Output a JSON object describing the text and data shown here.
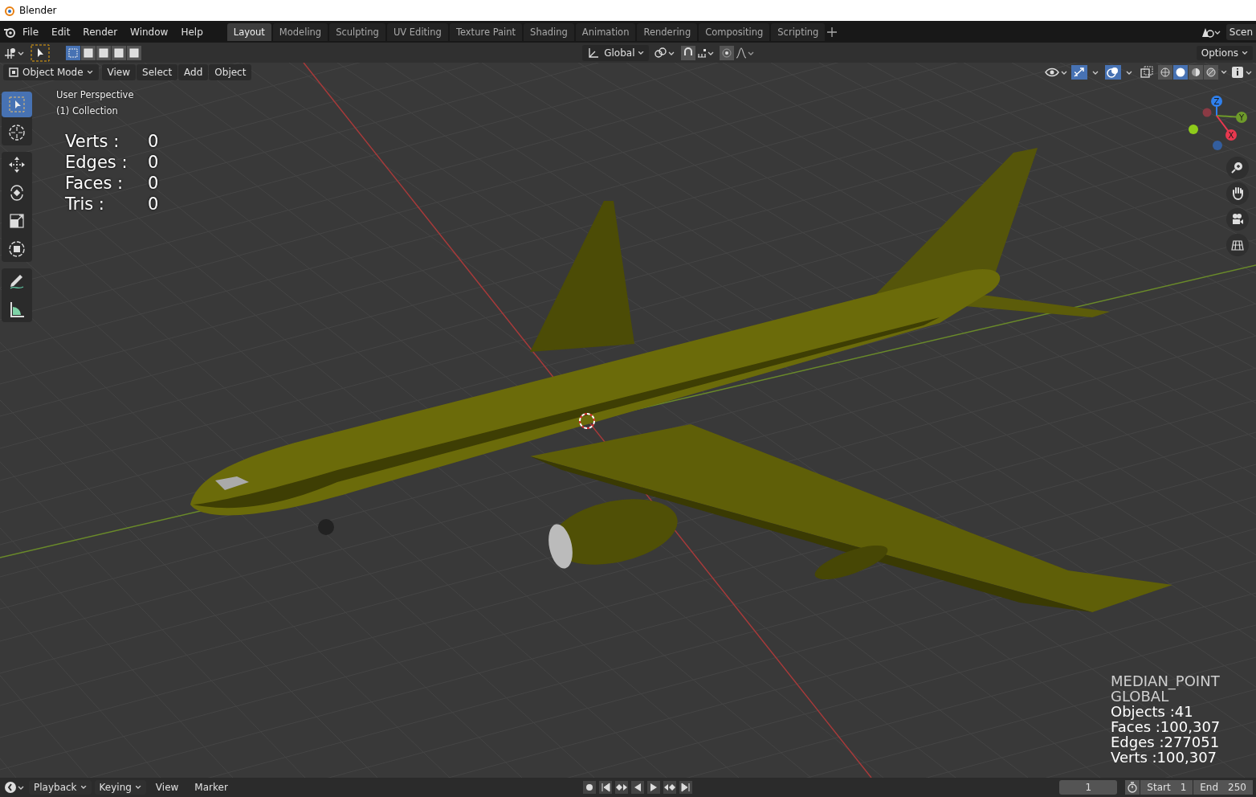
{
  "window": {
    "title": "Blender"
  },
  "menus": [
    "File",
    "Edit",
    "Render",
    "Window",
    "Help"
  ],
  "workspace_tabs": [
    {
      "label": "Layout",
      "selected": true
    },
    {
      "label": "Modeling",
      "selected": false
    },
    {
      "label": "Sculpting",
      "selected": false
    },
    {
      "label": "UV Editing",
      "selected": false
    },
    {
      "label": "Texture Paint",
      "selected": false
    },
    {
      "label": "Shading",
      "selected": false
    },
    {
      "label": "Animation",
      "selected": false
    },
    {
      "label": "Rendering",
      "selected": false
    },
    {
      "label": "Compositing",
      "selected": false
    },
    {
      "label": "Scripting",
      "selected": false
    }
  ],
  "scene_field": "Scen",
  "tool_header": {
    "select_modes": [
      {
        "selected": true
      },
      {
        "selected": false
      },
      {
        "selected": false
      },
      {
        "selected": false
      },
      {
        "selected": false
      }
    ],
    "orientation": "Global",
    "options": "Options"
  },
  "viewport_header": {
    "mode": "Object Mode",
    "menus": [
      "View",
      "Select",
      "Add",
      "Object"
    ],
    "shading_modes": [
      {
        "selected": false
      },
      {
        "selected": true
      },
      {
        "selected": false
      },
      {
        "selected": false
      }
    ]
  },
  "toolbar": [
    {
      "tools": [
        {
          "kind": "select",
          "selected": true
        },
        {
          "kind": "cursor",
          "selected": false
        }
      ]
    },
    {
      "tools": [
        {
          "kind": "move",
          "selected": false
        },
        {
          "kind": "rotate",
          "selected": false
        },
        {
          "kind": "scale",
          "selected": false
        },
        {
          "kind": "transform",
          "selected": false
        }
      ]
    },
    {
      "tools": [
        {
          "kind": "annotate",
          "selected": false
        },
        {
          "kind": "measure",
          "selected": false
        }
      ]
    }
  ],
  "overlay": {
    "view_name": "User Perspective",
    "collection": "(1) Collection"
  },
  "mesh_stats": [
    {
      "label": "Verts :",
      "value": "0"
    },
    {
      "label": "Edges :",
      "value": "0"
    },
    {
      "label": "Faces :",
      "value": "0"
    },
    {
      "label": "Tris :",
      "value": "0"
    }
  ],
  "scene_stats": [
    "MEDIAN_POINT",
    "GLOBAL",
    "Objects :41",
    "Faces :100,307",
    "Edges :277051",
    "Verts :100,307"
  ],
  "gizmo_axes": [
    {
      "label": "Z",
      "color": "#2f80ed"
    },
    {
      "label": "Y",
      "color": "#6e9a2a"
    },
    {
      "label": "X",
      "color": "#e8384f"
    }
  ],
  "nav_buttons": [
    {
      "kind": "zoom"
    },
    {
      "kind": "pan"
    },
    {
      "kind": "camera"
    },
    {
      "kind": "grid"
    }
  ],
  "timeline": {
    "menus": [
      "Playback",
      "Keying",
      "View",
      "Marker"
    ],
    "current_frame": "1",
    "start_label": "Start",
    "start": "1",
    "end_label": "End",
    "end": "250"
  }
}
